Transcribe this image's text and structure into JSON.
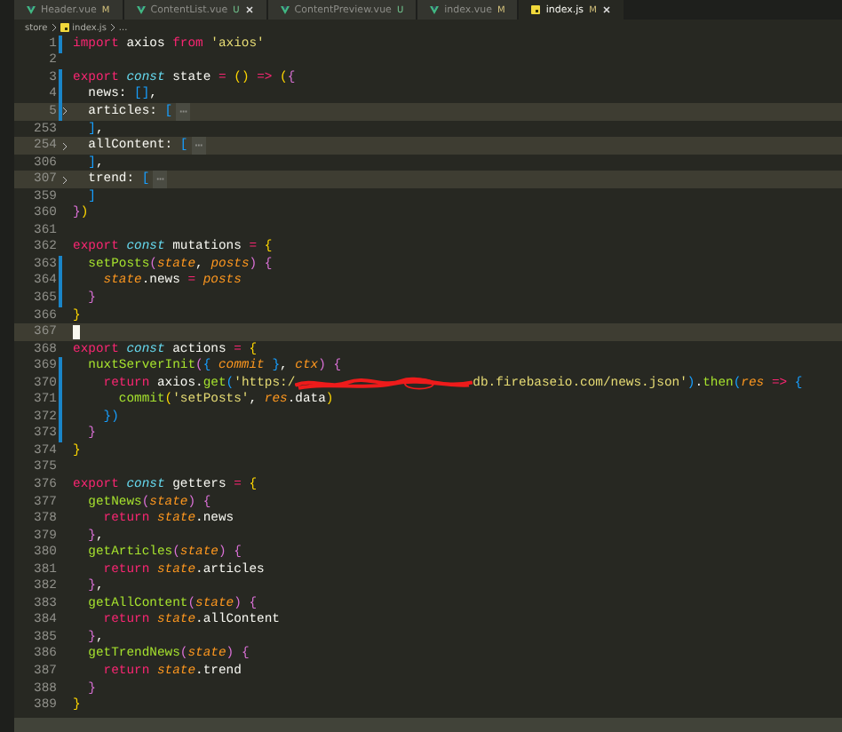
{
  "tabs": [
    {
      "kind": "vue",
      "label": "Header.vue",
      "status": "M",
      "closable": false,
      "selected": false
    },
    {
      "kind": "vue",
      "label": "ContentList.vue",
      "status": "U",
      "closable": true,
      "selected": false
    },
    {
      "kind": "vue",
      "label": "ContentPreview.vue",
      "status": "U",
      "closable": false,
      "selected": false
    },
    {
      "kind": "vue",
      "label": "index.vue",
      "status": "M",
      "closable": false,
      "selected": false
    },
    {
      "kind": "js",
      "label": "index.js",
      "status": "M",
      "closable": true,
      "selected": true
    }
  ],
  "breadcrumb": {
    "folder": "store",
    "file": "index.js",
    "more": "..."
  },
  "lines": [
    {
      "n": "1",
      "changed": true,
      "folded": false,
      "current": false,
      "tokens": [
        {
          "kind": "kw",
          "text": "import"
        },
        {
          "kind": "id",
          "text": " axios "
        },
        {
          "kind": "kw",
          "text": "from"
        },
        {
          "kind": "str",
          "text": " 'axios'"
        }
      ]
    },
    {
      "n": "2",
      "changed": false,
      "folded": false,
      "current": false
    },
    {
      "n": "3",
      "changed": true,
      "folded": false,
      "current": false,
      "tokens": [
        {
          "kind": "kw",
          "text": "export"
        },
        {
          "kind": "st",
          "text": " const"
        },
        {
          "kind": "id",
          "text": " state "
        },
        {
          "kind": "op",
          "text": "="
        },
        {
          "kind": "b1",
          "text": " ()"
        },
        {
          "kind": "op",
          "text": " =>"
        },
        {
          "kind": "b1",
          "text": " ("
        },
        {
          "kind": "b2",
          "text": "{"
        }
      ]
    },
    {
      "n": "4",
      "changed": true,
      "folded": false,
      "current": false,
      "tokens": [
        {
          "kind": "id",
          "text": "  news: "
        },
        {
          "kind": "b3",
          "text": "[]"
        },
        {
          "kind": "id",
          "text": ","
        }
      ]
    },
    {
      "n": "5",
      "changed": true,
      "folded": true,
      "current": false,
      "tokens": [
        {
          "kind": "id",
          "text": "  articles: "
        },
        {
          "kind": "b3",
          "text": "["
        },
        {
          "kind": "fold",
          "text": "⋯"
        }
      ]
    },
    {
      "n": "253",
      "changed": false,
      "folded": false,
      "current": false,
      "tokens": [
        {
          "kind": "b3",
          "text": "  ]"
        },
        {
          "kind": "id",
          "text": ","
        }
      ]
    },
    {
      "n": "254",
      "changed": false,
      "folded": true,
      "current": false,
      "tokens": [
        {
          "kind": "id",
          "text": "  allContent: "
        },
        {
          "kind": "b3",
          "text": "["
        },
        {
          "kind": "fold",
          "text": "⋯"
        }
      ]
    },
    {
      "n": "306",
      "changed": false,
      "folded": false,
      "current": false,
      "tokens": [
        {
          "kind": "b3",
          "text": "  ]"
        },
        {
          "kind": "id",
          "text": ","
        }
      ]
    },
    {
      "n": "307",
      "changed": false,
      "folded": true,
      "current": false,
      "tokens": [
        {
          "kind": "id",
          "text": "  trend: "
        },
        {
          "kind": "b3",
          "text": "["
        },
        {
          "kind": "fold",
          "text": "⋯"
        }
      ]
    },
    {
      "n": "359",
      "changed": false,
      "folded": false,
      "current": false,
      "tokens": [
        {
          "kind": "b3",
          "text": "  ]"
        }
      ]
    },
    {
      "n": "360",
      "changed": false,
      "folded": false,
      "current": false,
      "tokens": [
        {
          "kind": "b2",
          "text": "}"
        },
        {
          "kind": "b1",
          "text": ")"
        }
      ]
    },
    {
      "n": "361",
      "changed": false,
      "folded": false,
      "current": false
    },
    {
      "n": "362",
      "changed": false,
      "folded": false,
      "current": false,
      "tokens": [
        {
          "kind": "kw",
          "text": "export"
        },
        {
          "kind": "st",
          "text": " const"
        },
        {
          "kind": "id",
          "text": " mutations "
        },
        {
          "kind": "op",
          "text": "="
        },
        {
          "kind": "b1",
          "text": " {"
        }
      ]
    },
    {
      "n": "363",
      "changed": true,
      "folded": false,
      "current": false,
      "tokens": [
        {
          "kind": "fn",
          "text": "  setPosts"
        },
        {
          "kind": "b2",
          "text": "("
        },
        {
          "kind": "pa",
          "text": "state"
        },
        {
          "kind": "id",
          "text": ", "
        },
        {
          "kind": "pa",
          "text": "posts"
        },
        {
          "kind": "b2",
          "text": ")"
        },
        {
          "kind": "b2",
          "text": " {"
        }
      ]
    },
    {
      "n": "364",
      "changed": true,
      "folded": false,
      "current": false,
      "tokens": [
        {
          "kind": "pa",
          "text": "    state"
        },
        {
          "kind": "id",
          "text": ".news "
        },
        {
          "kind": "op",
          "text": "="
        },
        {
          "kind": "pa",
          "text": " posts"
        }
      ]
    },
    {
      "n": "365",
      "changed": true,
      "folded": false,
      "current": false,
      "tokens": [
        {
          "kind": "b2",
          "text": "  }"
        }
      ]
    },
    {
      "n": "366",
      "changed": false,
      "folded": false,
      "current": false,
      "tokens": [
        {
          "kind": "b1",
          "text": "}"
        }
      ]
    },
    {
      "n": "367",
      "changed": false,
      "folded": false,
      "current": true
    },
    {
      "n": "368",
      "changed": false,
      "folded": false,
      "current": false,
      "tokens": [
        {
          "kind": "kw",
          "text": "export"
        },
        {
          "kind": "st",
          "text": " const"
        },
        {
          "kind": "id",
          "text": " actions "
        },
        {
          "kind": "op",
          "text": "="
        },
        {
          "kind": "b1",
          "text": " {"
        }
      ]
    },
    {
      "n": "369",
      "changed": true,
      "folded": false,
      "current": false,
      "tokens": [
        {
          "kind": "fn",
          "text": "  nuxtServerInit"
        },
        {
          "kind": "b2",
          "text": "("
        },
        {
          "kind": "b3",
          "text": "{"
        },
        {
          "kind": "pa",
          "text": " commit "
        },
        {
          "kind": "b3",
          "text": "}"
        },
        {
          "kind": "id",
          "text": ", "
        },
        {
          "kind": "pa",
          "text": "ctx"
        },
        {
          "kind": "b2",
          "text": ")"
        },
        {
          "kind": "b2",
          "text": " {"
        }
      ]
    },
    {
      "n": "370",
      "changed": true,
      "folded": false,
      "current": false,
      "tokens": [
        {
          "kind": "kw",
          "text": "    return"
        },
        {
          "kind": "id",
          "text": " axios."
        },
        {
          "kind": "fn",
          "text": "get"
        },
        {
          "kind": "b3",
          "text": "("
        },
        {
          "kind": "str",
          "text": "'https:/"
        },
        {
          "kind": "redacted"
        },
        {
          "kind": "str",
          "text": "db.firebaseio.com/news.json'"
        },
        {
          "kind": "b3",
          "text": ")"
        },
        {
          "kind": "id",
          "text": "."
        },
        {
          "kind": "fn",
          "text": "then"
        },
        {
          "kind": "b3",
          "text": "("
        },
        {
          "kind": "pa",
          "text": "res"
        },
        {
          "kind": "op",
          "text": " =>"
        },
        {
          "kind": "b3",
          "text": " {"
        }
      ]
    },
    {
      "n": "371",
      "changed": true,
      "folded": false,
      "current": false,
      "tokens": [
        {
          "kind": "fn",
          "text": "      commit"
        },
        {
          "kind": "b1",
          "text": "("
        },
        {
          "kind": "str",
          "text": "'setPosts'"
        },
        {
          "kind": "id",
          "text": ", "
        },
        {
          "kind": "pa",
          "text": "res"
        },
        {
          "kind": "id",
          "text": ".data"
        },
        {
          "kind": "b1",
          "text": ")"
        }
      ]
    },
    {
      "n": "372",
      "changed": true,
      "folded": false,
      "current": false,
      "tokens": [
        {
          "kind": "b3",
          "text": "    })"
        }
      ]
    },
    {
      "n": "373",
      "changed": true,
      "folded": false,
      "current": false,
      "tokens": [
        {
          "kind": "b2",
          "text": "  }"
        }
      ]
    },
    {
      "n": "374",
      "changed": false,
      "folded": false,
      "current": false,
      "tokens": [
        {
          "kind": "b1",
          "text": "}"
        }
      ]
    },
    {
      "n": "375",
      "changed": false,
      "folded": false,
      "current": false
    },
    {
      "n": "376",
      "changed": false,
      "folded": false,
      "current": false,
      "tokens": [
        {
          "kind": "kw",
          "text": "export"
        },
        {
          "kind": "st",
          "text": " const"
        },
        {
          "kind": "id",
          "text": " getters "
        },
        {
          "kind": "op",
          "text": "="
        },
        {
          "kind": "b1",
          "text": " {"
        }
      ]
    },
    {
      "n": "377",
      "changed": false,
      "folded": false,
      "current": false,
      "tokens": [
        {
          "kind": "fn",
          "text": "  getNews"
        },
        {
          "kind": "b2",
          "text": "("
        },
        {
          "kind": "pa",
          "text": "state"
        },
        {
          "kind": "b2",
          "text": ")"
        },
        {
          "kind": "b2",
          "text": " {"
        }
      ]
    },
    {
      "n": "378",
      "changed": false,
      "folded": false,
      "current": false,
      "tokens": [
        {
          "kind": "kw",
          "text": "    return"
        },
        {
          "kind": "pa",
          "text": " state"
        },
        {
          "kind": "id",
          "text": ".news"
        }
      ]
    },
    {
      "n": "379",
      "changed": false,
      "folded": false,
      "current": false,
      "tokens": [
        {
          "kind": "b2",
          "text": "  }"
        },
        {
          "kind": "id",
          "text": ","
        }
      ]
    },
    {
      "n": "380",
      "changed": false,
      "folded": false,
      "current": false,
      "tokens": [
        {
          "kind": "fn",
          "text": "  getArticles"
        },
        {
          "kind": "b2",
          "text": "("
        },
        {
          "kind": "pa",
          "text": "state"
        },
        {
          "kind": "b2",
          "text": ")"
        },
        {
          "kind": "b2",
          "text": " {"
        }
      ]
    },
    {
      "n": "381",
      "changed": false,
      "folded": false,
      "current": false,
      "tokens": [
        {
          "kind": "kw",
          "text": "    return"
        },
        {
          "kind": "pa",
          "text": " state"
        },
        {
          "kind": "id",
          "text": ".articles"
        }
      ]
    },
    {
      "n": "382",
      "changed": false,
      "folded": false,
      "current": false,
      "tokens": [
        {
          "kind": "b2",
          "text": "  }"
        },
        {
          "kind": "id",
          "text": ","
        }
      ]
    },
    {
      "n": "383",
      "changed": false,
      "folded": false,
      "current": false,
      "tokens": [
        {
          "kind": "fn",
          "text": "  getAllContent"
        },
        {
          "kind": "b2",
          "text": "("
        },
        {
          "kind": "pa",
          "text": "state"
        },
        {
          "kind": "b2",
          "text": ")"
        },
        {
          "kind": "b2",
          "text": " {"
        }
      ]
    },
    {
      "n": "384",
      "changed": false,
      "folded": false,
      "current": false,
      "tokens": [
        {
          "kind": "kw",
          "text": "    return"
        },
        {
          "kind": "pa",
          "text": " state"
        },
        {
          "kind": "id",
          "text": ".allContent"
        }
      ]
    },
    {
      "n": "385",
      "changed": false,
      "folded": false,
      "current": false,
      "tokens": [
        {
          "kind": "b2",
          "text": "  }"
        },
        {
          "kind": "id",
          "text": ","
        }
      ]
    },
    {
      "n": "386",
      "changed": false,
      "folded": false,
      "current": false,
      "tokens": [
        {
          "kind": "fn",
          "text": "  getTrendNews"
        },
        {
          "kind": "b2",
          "text": "("
        },
        {
          "kind": "pa",
          "text": "state"
        },
        {
          "kind": "b2",
          "text": ")"
        },
        {
          "kind": "b2",
          "text": " {"
        }
      ]
    },
    {
      "n": "387",
      "changed": false,
      "folded": false,
      "current": false,
      "tokens": [
        {
          "kind": "kw",
          "text": "    return"
        },
        {
          "kind": "pa",
          "text": " state"
        },
        {
          "kind": "id",
          "text": ".trend"
        }
      ]
    },
    {
      "n": "388",
      "changed": false,
      "folded": false,
      "current": false,
      "tokens": [
        {
          "kind": "b2",
          "text": "  }"
        }
      ]
    },
    {
      "n": "389",
      "changed": false,
      "folded": false,
      "current": false,
      "tokens": [
        {
          "kind": "b1",
          "text": "}"
        }
      ]
    }
  ]
}
